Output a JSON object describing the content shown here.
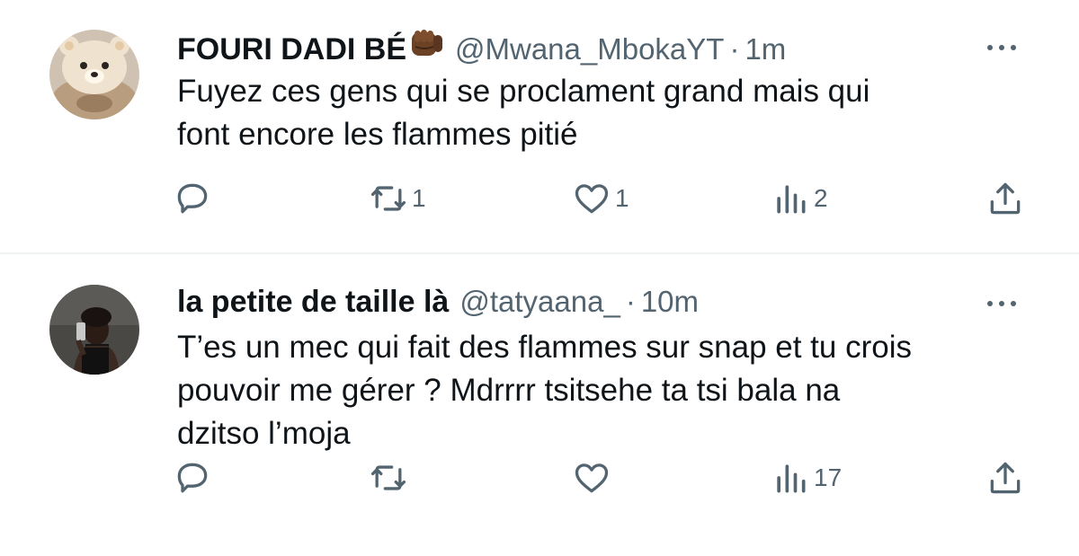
{
  "tweets": [
    {
      "name": "FOURI DADI BÉ",
      "handle": "@Mwana_MbokaYT",
      "separator": "·",
      "time": "1m",
      "text": "Fuyez ces gens qui se proclament grand mais qui\nfont encore les flammes pitié",
      "retweets": "1",
      "likes": "1",
      "views": "2",
      "emoji": "oncoming-fist-emoji"
    },
    {
      "name": "la petite de taille là",
      "handle": "@tatyaana_",
      "separator": "·",
      "time": "10m",
      "text": "T’es un mec qui fait des flammes sur snap et tu crois\npouvoir me gérer ? Mdrrrr tsitsehe ta tsi bala na\ndzitso l’moja",
      "retweets": "",
      "likes": "",
      "views": "17"
    }
  ],
  "colors": {
    "text": "#0f1419",
    "secondary": "#536471",
    "divider": "#eff3f4"
  }
}
